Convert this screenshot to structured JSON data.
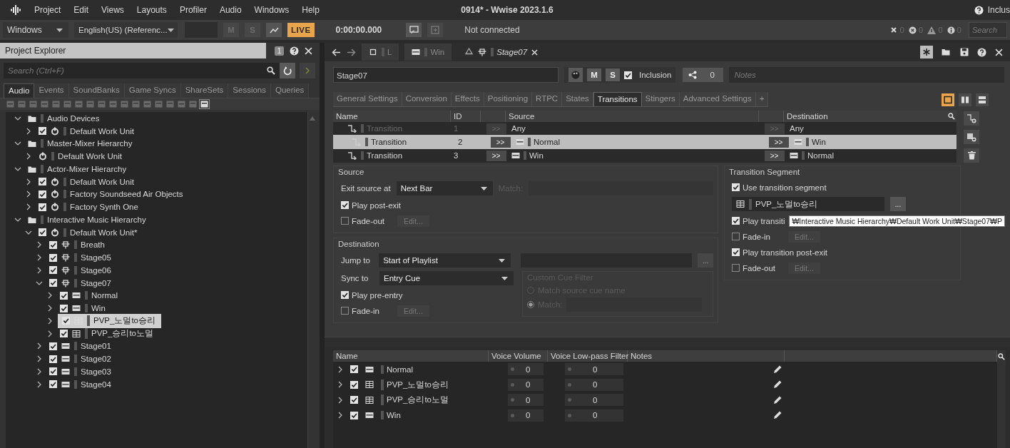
{
  "menu_bar": {
    "items": [
      "Project",
      "Edit",
      "Views",
      "Layouts",
      "Profiler",
      "Audio",
      "Windows",
      "Help"
    ],
    "title": "0914* - Wwise 2023.1.6",
    "right_label": "Inclus"
  },
  "toolbar": {
    "platform": "Windows",
    "language": "English(US) (Referenc...",
    "mute": "M",
    "solo": "S",
    "live": "LIVE",
    "time": "0:00:00.000",
    "connection": "Not connected",
    "counters": [
      "0",
      "0",
      "0",
      "0"
    ],
    "search": {
      "placeholder": "Search"
    }
  },
  "project_explorer": {
    "title": "Project Explorer",
    "layout_number": "1",
    "search": {
      "placeholder": "Search (Ctrl+F)"
    },
    "tabs": [
      {
        "label": "Audio",
        "selected": true
      },
      {
        "label": "Events",
        "selected": false
      },
      {
        "label": "SoundBanks",
        "selected": false
      },
      {
        "label": "Game Syncs",
        "selected": false
      },
      {
        "label": "ShareSets",
        "selected": false
      },
      {
        "label": "Sessions",
        "selected": false
      },
      {
        "label": "Queries",
        "selected": false
      }
    ],
    "tree": [
      {
        "label": "Audio Devices",
        "kind": "folder",
        "expanded": true,
        "selected": false,
        "children": [
          {
            "label": "Default Work Unit",
            "kind": "work_unit",
            "checked": true,
            "expanded": false,
            "selected": false
          }
        ]
      },
      {
        "label": "Master-Mixer Hierarchy",
        "kind": "folder",
        "expanded": true,
        "selected": false,
        "children": [
          {
            "label": "Default Work Unit",
            "kind": "work_unit",
            "expanded": false,
            "selected": false
          }
        ]
      },
      {
        "label": "Actor-Mixer Hierarchy",
        "kind": "folder",
        "expanded": true,
        "selected": false,
        "children": [
          {
            "label": "Default Work Unit",
            "kind": "work_unit",
            "checked": true,
            "expanded": false,
            "selected": false
          },
          {
            "label": "Factory Soundseed Air Objects",
            "kind": "work_unit",
            "checked": true,
            "expanded": false,
            "selected": false
          },
          {
            "label": "Factory Synth One",
            "kind": "work_unit",
            "checked": true,
            "expanded": false,
            "selected": false
          }
        ]
      },
      {
        "label": "Interactive Music Hierarchy",
        "kind": "folder",
        "expanded": true,
        "selected": false,
        "children": [
          {
            "label": "Default Work Unit*",
            "kind": "work_unit",
            "checked": true,
            "expanded": true,
            "selected": false,
            "children": [
              {
                "label": "Breath",
                "kind": "switch",
                "checked": true,
                "expanded": false,
                "selected": false
              },
              {
                "label": "Stage05",
                "kind": "switch",
                "checked": true,
                "expanded": false,
                "selected": false
              },
              {
                "label": "Stage06",
                "kind": "switch",
                "checked": true,
                "expanded": false,
                "selected": false
              },
              {
                "label": "Stage07",
                "kind": "switch",
                "checked": true,
                "expanded": true,
                "selected": false,
                "children": [
                  {
                    "label": "Normal",
                    "kind": "playlist",
                    "checked": true,
                    "expanded": false,
                    "selected": false
                  },
                  {
                    "label": "Win",
                    "kind": "playlist",
                    "checked": true,
                    "expanded": false,
                    "selected": false
                  },
                  {
                    "label": "PVP_노멀to승리",
                    "kind": "grid",
                    "checked": true,
                    "expanded": false,
                    "selected": true
                  },
                  {
                    "label": "PVP_승리to노멀",
                    "kind": "grid",
                    "checked": true,
                    "expanded": false,
                    "selected": false
                  }
                ]
              },
              {
                "label": "Stage01",
                "kind": "playlist",
                "checked": true,
                "expanded": false,
                "selected": false
              },
              {
                "label": "Stage02",
                "kind": "playlist",
                "checked": true,
                "expanded": false,
                "selected": false
              },
              {
                "label": "Stage03",
                "kind": "playlist",
                "checked": true,
                "expanded": false,
                "selected": false
              },
              {
                "label": "Stage04",
                "kind": "playlist",
                "checked": true,
                "expanded": false,
                "selected": false
              }
            ]
          }
        ]
      }
    ]
  },
  "property_editor": {
    "history_tabs": [
      {
        "label": "L",
        "kind": "square",
        "selected": false
      },
      {
        "label": "Win",
        "kind": "playlist",
        "selected": false
      },
      {
        "label": "Stage07",
        "kind": "switch",
        "selected": true
      }
    ],
    "object_name": "Stage07",
    "mute": "M",
    "solo": "S",
    "inclusion": {
      "label": "Inclusion",
      "checked": true
    },
    "share_count": "0",
    "notes": {
      "placeholder": "Notes"
    },
    "tabs": [
      {
        "label": "General Settings",
        "selected": false
      },
      {
        "label": "Conversion",
        "selected": false
      },
      {
        "label": "Effects",
        "selected": false
      },
      {
        "label": "Positioning",
        "selected": false
      },
      {
        "label": "RTPC",
        "selected": false
      },
      {
        "label": "States",
        "selected": false
      },
      {
        "label": "Transitions",
        "selected": true
      },
      {
        "label": "Stingers",
        "selected": false
      },
      {
        "label": "Advanced Settings",
        "selected": false
      },
      {
        "label": "+",
        "selected": false
      }
    ],
    "layout_buttons": [
      {
        "kind": "single",
        "selected": true
      },
      {
        "kind": "columns",
        "selected": false
      },
      {
        "kind": "rows",
        "selected": false
      }
    ],
    "transitions": {
      "columns": [
        "Name",
        "ID",
        "Source",
        "Destination"
      ],
      "rows": [
        {
          "name": "Transition",
          "id": "1",
          "source_arrow": ">>",
          "source": {
            "name": "Any"
          },
          "destination_arrow": ">>",
          "destination": {
            "name": "Any"
          },
          "disabled": true,
          "selected": false
        },
        {
          "name": "Transition",
          "id": "2",
          "source_arrow": ">>",
          "source": {
            "name": "Normal",
            "kind": "playlist"
          },
          "destination_arrow": ">>",
          "destination": {
            "name": "Win",
            "kind": "playlist"
          },
          "disabled": false,
          "selected": true
        },
        {
          "name": "Transition",
          "id": "3",
          "source_arrow": ">>",
          "source": {
            "name": "Win",
            "kind": "playlist"
          },
          "destination_arrow": ">>",
          "destination": {
            "name": "Normal",
            "kind": "playlist"
          },
          "disabled": false,
          "selected": false
        }
      ]
    },
    "source": {
      "title": "Source",
      "exit_label": "Exit source at",
      "exit_value": "Next Bar",
      "match_label": "Match:",
      "post_exit": {
        "label": "Play post-exit",
        "checked": true
      },
      "fade_out": {
        "label": "Fade-out",
        "checked": false,
        "button": "Edit..."
      }
    },
    "destination": {
      "title": "Destination",
      "jump_label": "Jump to",
      "jump_value": "Start of Playlist",
      "browse": "...",
      "sync_label": "Sync to",
      "sync_value": "Entry Cue",
      "cue_filter": {
        "title": "Custom Cue Filter",
        "options": [
          {
            "label": "Match source cue name",
            "selected": false
          },
          {
            "label": "Match:",
            "selected": true
          }
        ]
      },
      "pre_entry": {
        "label": "Play pre-entry",
        "checked": true
      },
      "fade_in": {
        "label": "Fade-in",
        "checked": false,
        "button": "Edit..."
      }
    },
    "transition_segment": {
      "title": "Transition Segment",
      "use": {
        "label": "Use transition segment",
        "checked": true
      },
      "segment": "PVP_노멀to승리",
      "browse": "...",
      "pre_entry": {
        "label": "Play transiti",
        "checked": true
      },
      "fade_in": {
        "label": "Fade-in",
        "checked": false,
        "button": "Edit..."
      },
      "post_exit": {
        "label": "Play transition post-exit",
        "checked": true
      },
      "fade_out": {
        "label": "Fade-out",
        "checked": false,
        "button": "Edit..."
      }
    },
    "tooltip": "₩Interactive Music Hierarchy₩Default Work Unit₩Stage07₩P",
    "contents_list": {
      "columns": [
        "Name",
        "Voice Volume",
        "Voice Low-pass Filter",
        "Notes"
      ],
      "rows": [
        {
          "name": "Normal",
          "kind": "playlist",
          "checked": true,
          "volume": "0",
          "lowpass": "0"
        },
        {
          "name": "PVP_노멀to승리",
          "kind": "grid",
          "checked": true,
          "volume": "0",
          "lowpass": "0"
        },
        {
          "name": "PVP_승리to노멀",
          "kind": "grid",
          "checked": true,
          "volume": "0",
          "lowpass": "0"
        },
        {
          "name": "Win",
          "kind": "playlist",
          "checked": true,
          "volume": "0",
          "lowpass": "0"
        }
      ]
    }
  }
}
